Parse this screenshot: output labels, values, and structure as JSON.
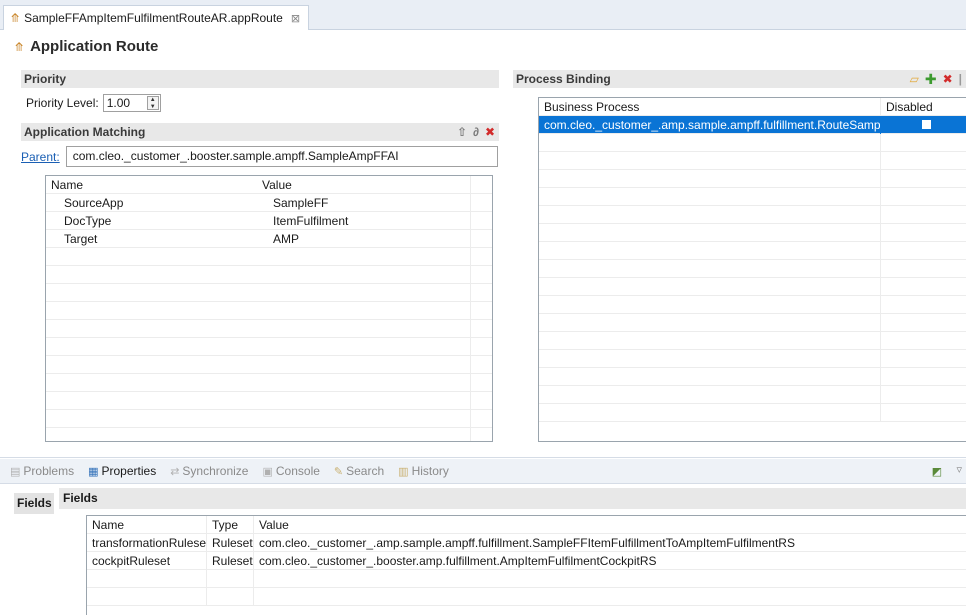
{
  "editor_tab": {
    "label": "SampleFFAmpItemFulfilmentRouteAR.appRoute",
    "close_glyph": "⊠",
    "icon": "route-pin-icon"
  },
  "page": {
    "title": "Application Route",
    "icon": "route-pin-icon"
  },
  "priority": {
    "section_label": "Priority",
    "level_label": "Priority Level:",
    "level_value": "1.00"
  },
  "application_matching": {
    "section_label": "Application Matching",
    "parent_label": "Parent:",
    "parent_value": "com.cleo._customer_.booster.sample.ampff.SampleAmpFFAI",
    "columns": [
      "Name",
      "Value"
    ],
    "rows": [
      {
        "name": "SourceApp",
        "value": "SampleFF"
      },
      {
        "name": "DocType",
        "value": "ItemFulfilment"
      },
      {
        "name": "Target",
        "value": "AMP"
      }
    ],
    "toolbar_icons": [
      "move-up-icon",
      "edit-icon",
      "delete-icon"
    ]
  },
  "process_binding": {
    "section_label": "Process Binding",
    "columns": [
      "Business Process",
      "Disabled"
    ],
    "rows": [
      {
        "process": "com.cleo._customer_.amp.sample.ampff.fulfillment.RouteSample...",
        "disabled": false
      }
    ],
    "toolbar_icons": [
      "open-folder-icon",
      "add-icon",
      "delete-icon"
    ]
  },
  "views": {
    "tabs": [
      {
        "label": "Problems",
        "icon": "problems-icon",
        "active": false
      },
      {
        "label": "Properties",
        "icon": "properties-icon",
        "active": true
      },
      {
        "label": "Synchronize",
        "icon": "synchronize-icon",
        "active": false
      },
      {
        "label": "Console",
        "icon": "console-icon",
        "active": false
      },
      {
        "label": "Search",
        "icon": "search-icon",
        "active": false
      },
      {
        "label": "History",
        "icon": "history-icon",
        "active": false
      }
    ]
  },
  "properties": {
    "side_tab": "Fields",
    "section_label": "Fields",
    "columns": [
      "Name",
      "Type",
      "Value"
    ],
    "rows": [
      {
        "name": "transformationRuleset",
        "type": "Ruleset",
        "value": "com.cleo._customer_.amp.sample.ampff.fulfillment.SampleFFItemFulfillmentToAmpItemFulfilmentRS"
      },
      {
        "name": "cockpitRuleset",
        "type": "Ruleset",
        "value": "com.cleo._customer_.booster.amp.fulfillment.AmpItemFulfilmentCockpitRS"
      }
    ]
  },
  "colors": {
    "selection": "#0a74d5",
    "link": "#1a5fb4",
    "delete": "#d22b2b",
    "add": "#3c9a2e",
    "folder": "#e3a93a"
  }
}
